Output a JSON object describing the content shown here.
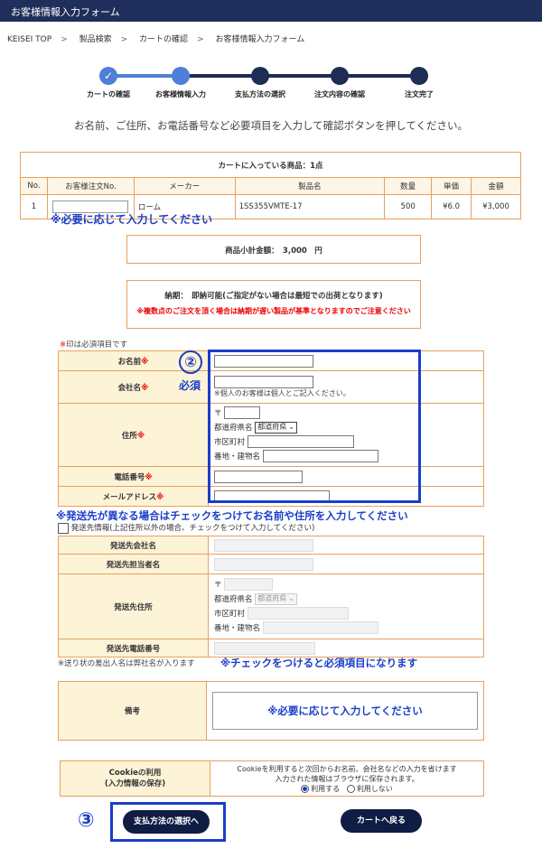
{
  "header": {
    "title": "お客様情報入力フォーム"
  },
  "breadcrumb": [
    "KEISEI TOP",
    "製品検索",
    "カートの確認",
    "お客様情報入力フォーム"
  ],
  "breadcrumb_sep": ">",
  "steps": [
    {
      "label": "カートの確認",
      "state": "done",
      "check": "✓"
    },
    {
      "label": "お客様情報入力",
      "state": "current"
    },
    {
      "label": "支払方法の選択",
      "state": "todo"
    },
    {
      "label": "注文内容の確認",
      "state": "todo"
    },
    {
      "label": "注文完了",
      "state": "todo"
    }
  ],
  "lead": "お名前、ご住所、お電話番号など必要項目を入力して確認ボタンを押してください。",
  "cart": {
    "caption": "カートに入っている商品：1点",
    "headers": [
      "No.",
      "お客様注文No.",
      "メーカー",
      "製品名",
      "数量",
      "単価",
      "金額"
    ],
    "row": {
      "no": "1",
      "order_no": "",
      "maker": "ローム",
      "product": "1SS355VMTE-17",
      "qty": "500",
      "unit": "¥6.0",
      "amount": "¥3,000"
    },
    "note": "※必要に応じて入力してください"
  },
  "subtotal": "商品小計金額：　3,000　円",
  "delivery": {
    "line": "納期：　即納可能(ご指定がない場合は最短での出荷となります)",
    "warning": "※複数点のご注文を頂く場合は納期が遅い製品が基準となりますのでご注意ください"
  },
  "required_note": {
    "mark": "※",
    "text": "印は必須項目です"
  },
  "annotation": {
    "number": "②",
    "required": "必須"
  },
  "customer": {
    "name_label": "お名前",
    "company_label": "会社名",
    "company_hint": "※個人のお客様は個人とご記入ください。",
    "address_label": "住所",
    "zip_mark": "〒",
    "pref_label": "都道府県名",
    "pref_value": "都道府県",
    "city_label": "市区町村",
    "street_label": "番地・建物名",
    "phone_label": "電話番号",
    "email_label": "メールアドレス",
    "req": "※"
  },
  "shipping_note": "※発送先が異なる場合はチェックをつけてお名前や住所を入力してください",
  "shipping_checkbox_label": "発送先情報(上記住所以外の場合、チェックをつけて入力してください)",
  "shipping": {
    "company_label": "発送先会社名",
    "person_label": "発送先担当者名",
    "address_label": "発送先住所",
    "zip_mark": "〒",
    "pref_label": "都道府県名",
    "pref_value": "都道府県",
    "city_label": "市区町村",
    "street_label": "番地・建物名",
    "phone_label": "発送先電話番号"
  },
  "sender_note": "※送り状の差出人名は弊社名が入ります",
  "check_required_note": "※チェックをつけると必須項目になります",
  "remarks": {
    "label": "備考",
    "placeholder_note": "※必要に応じて入力してください"
  },
  "cookie": {
    "label_line1": "Cookieの利用",
    "label_line2": "(入力情報の保存)",
    "desc_line1": "Cookieを利用すると次回からお名前、会社名などの入力を省けます",
    "desc_line2": "入力された情報はブラウザに保存されます。",
    "opt_yes": "利用する",
    "opt_no": "利用しない",
    "selected": "利用する"
  },
  "annotation3": "③",
  "buttons": {
    "next": "支払方法の選択へ",
    "back": "カートへ戻る"
  },
  "colors": {
    "accent": "#1a3ec9",
    "navy": "#1f2e5a",
    "orange_border": "#e6a15e",
    "label_bg": "#fdf3d7",
    "required_red": "#e00000"
  }
}
